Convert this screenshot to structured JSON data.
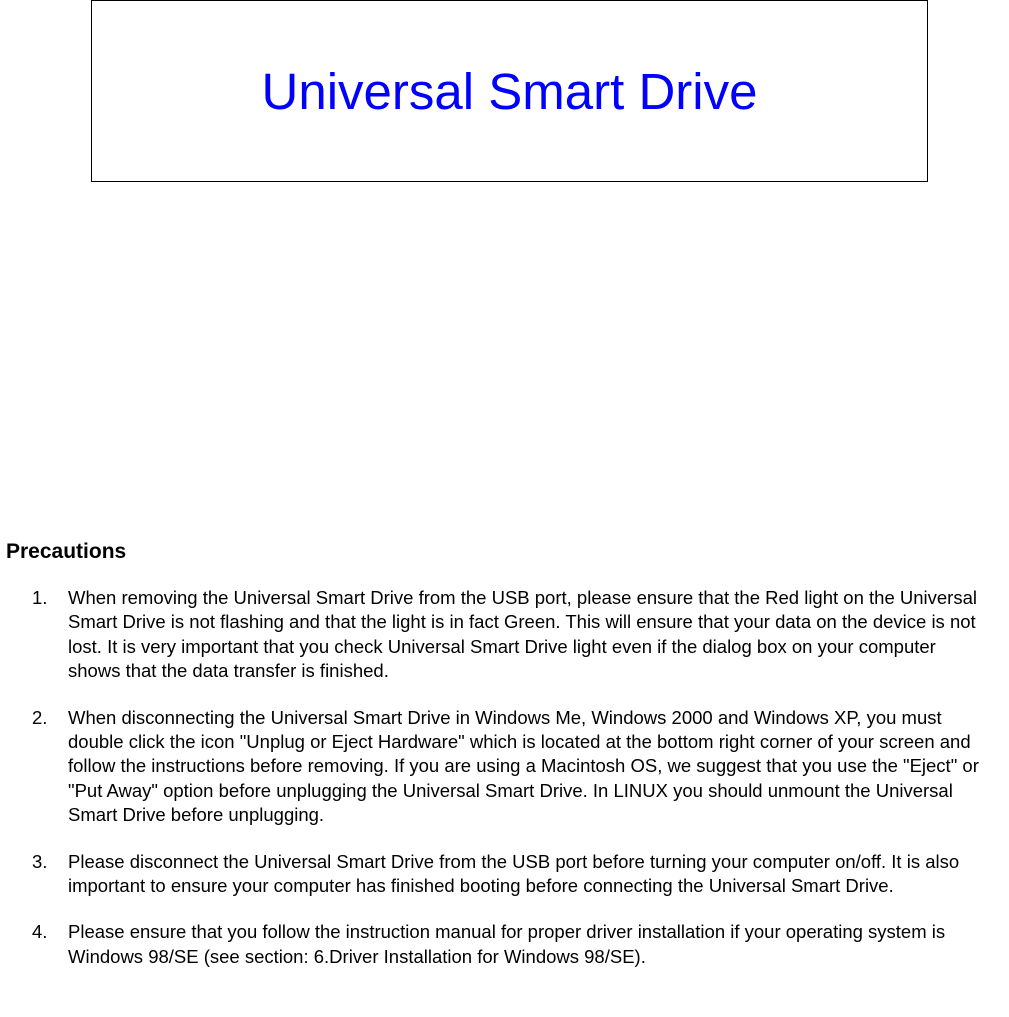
{
  "title": "Universal Smart Drive",
  "section_heading": "Precautions",
  "items": [
    {
      "number": "1.",
      "text": "When removing the Universal Smart Drive from the USB port, please ensure that the Red light on the Universal Smart Drive is not flashing and that the light is in fact Green. This will ensure that your data on the device is not lost. It is very important that you check Universal Smart Drive light even if the dialog box on your computer shows that the data transfer is finished."
    },
    {
      "number": "2.",
      "text": "When disconnecting the Universal Smart Drive in Windows Me, Windows 2000 and Windows XP, you must double click the icon \"Unplug or Eject Hardware\" which is located at the bottom right corner of your screen and follow the instructions before removing. If you are using a Macintosh OS, we suggest that you use the \"Eject\" or \"Put Away\" option before unplugging the Universal Smart Drive. In LINUX you should unmount the Universal Smart Drive before unplugging."
    },
    {
      "number": "3.",
      "text": "Please disconnect the Universal Smart Drive from the USB port before turning your computer on/off. It is also important to ensure your computer has finished booting before connecting the Universal Smart Drive."
    },
    {
      "number": "4.",
      "text": "Please ensure that you follow the instruction manual for proper driver installation if your operating system is Windows 98/SE (see section: 6.Driver Installation for Windows 98/SE)."
    }
  ]
}
